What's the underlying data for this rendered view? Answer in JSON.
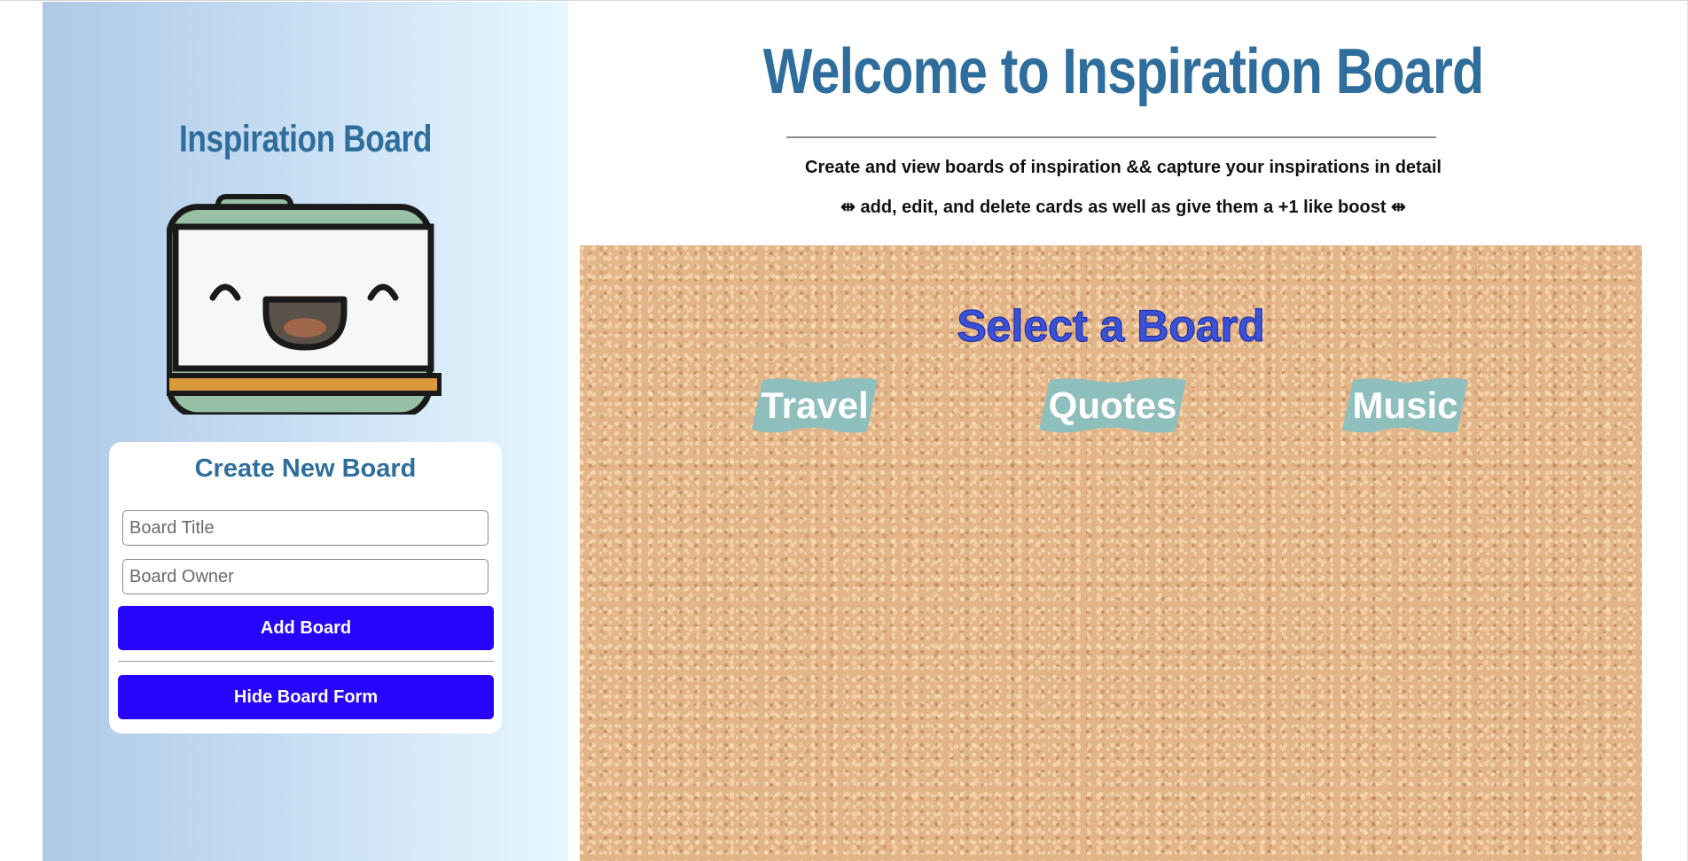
{
  "sidebar": {
    "title": "Inspiration Board",
    "gradient": [
      "#afc9e8",
      "#e6f8fe"
    ]
  },
  "form": {
    "title": "Create New Board",
    "title_placeholder": "Board Title",
    "owner_placeholder": "Board Owner",
    "add_label": "Add Board",
    "hide_label": "Hide Board Form",
    "button_color": "#2705fa"
  },
  "main": {
    "title": "Welcome to Inspiration Board",
    "subtitle": "Create and view boards of inspiration && capture your inspirations in detail",
    "tagline": "⇹ add, edit, and delete cards as well as give them a +1 like boost ⇹"
  },
  "board_area": {
    "title": "Select a Board",
    "boards": [
      {
        "label": "Travel"
      },
      {
        "label": "Quotes"
      },
      {
        "label": "Music"
      }
    ],
    "tag_color": "#8fbfbd"
  },
  "colors": {
    "heading": "#2f6e9c",
    "select_title": "#3c52d6"
  },
  "icons": [
    "smiling-folder-mascot-icon"
  ]
}
